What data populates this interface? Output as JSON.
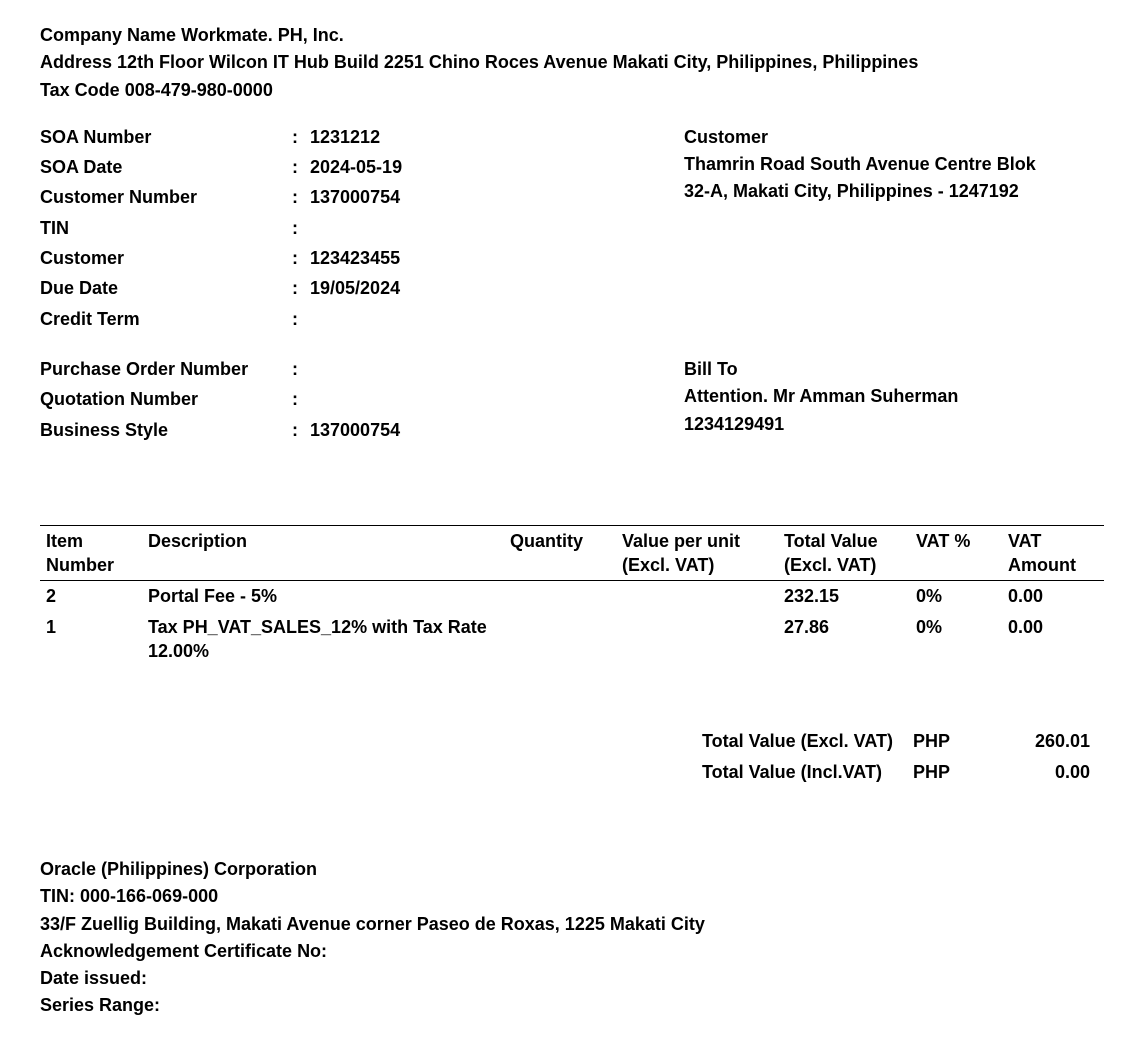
{
  "header": {
    "company_label": "Company Name",
    "company_name": "Workmate. PH, Inc.",
    "address_label": "Address",
    "address": "12th Floor Wilcon IT Hub Build 2251 Chino Roces Avenue Makati City, Philippines, Philippines",
    "taxcode_label": "Tax Code",
    "taxcode": "008-479-980-0000"
  },
  "details1": {
    "soa_number_label": "SOA Number",
    "soa_number": "1231212",
    "soa_date_label": "SOA Date",
    "soa_date": "2024-05-19",
    "customer_number_label": "Customer Number",
    "customer_number": "137000754",
    "tin_label": "TIN",
    "tin": "",
    "customer_label": "Customer",
    "customer": "123423455",
    "due_date_label": "Due Date",
    "due_date": "19/05/2024",
    "credit_term_label": "Credit Term",
    "credit_term": ""
  },
  "details2": {
    "po_label": "Purchase Order Number",
    "po": "",
    "qn_label": "Quotation Number",
    "qn": "",
    "bs_label": "Business Style",
    "bs": "137000754"
  },
  "customer": {
    "title": "Customer",
    "line1": "Thamrin Road South Avenue Centre Blok",
    "line2": "32-A, Makati City, Philippines - 1247192"
  },
  "bill_to": {
    "title": "Bill To",
    "attention": "Attention. Mr Amman Suherman",
    "number": "1234129491"
  },
  "items": {
    "headers": {
      "num": "Item Number",
      "desc": "Description",
      "qty": "Quantity",
      "unit": "Value per unit (Excl. VAT)",
      "total": "Total Value (Excl. VAT)",
      "vatp": "VAT %",
      "vata": "VAT Amount"
    },
    "rows": [
      {
        "num": "2",
        "desc": "Portal Fee - 5%",
        "qty": "",
        "unit": "",
        "total": "232.15",
        "vatp": "0%",
        "vata": "0.00"
      },
      {
        "num": "1",
        "desc": "Tax PH_VAT_SALES_12%   with Tax Rate 12.00%",
        "qty": "",
        "unit": "",
        "total": "27.86",
        "vatp": "0%",
        "vata": "0.00"
      }
    ]
  },
  "totals": {
    "excl_label": "Total Value (Excl. VAT)",
    "excl_cur": "PHP",
    "excl_val": "260.01",
    "incl_label": "Total Value (Incl.VAT)",
    "incl_cur": "PHP",
    "incl_val": "0.00"
  },
  "footer": {
    "company": "Oracle (Philippines) Corporation",
    "tin": "TIN: 000-166-069-000",
    "address": "33/F Zuellig Building, Makati Avenue corner Paseo de Roxas, 1225 Makati City",
    "ack": "Acknowledgement Certificate No:",
    "date_issued": "Date issued:",
    "series": "Series Range:"
  }
}
